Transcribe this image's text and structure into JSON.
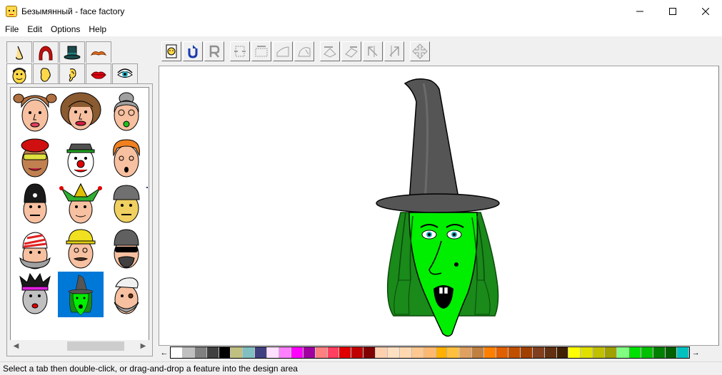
{
  "window": {
    "title": "Безымянный - face factory",
    "minimize_glyph": "—",
    "maximize_glyph": "☐",
    "close_glyph": "✕"
  },
  "menu": {
    "items": [
      "File",
      "Edit",
      "Options",
      "Help"
    ]
  },
  "feature_tabs": {
    "row1": [
      "nose-icon",
      "hair-icon",
      "hat-icon",
      "mustache-icon"
    ],
    "row2": [
      "face-icon",
      "head-shape-icon",
      "ear-icon",
      "lips-icon",
      "eye-icon"
    ],
    "active": "face-icon"
  },
  "toolbar": {
    "buttons": [
      "new-face-icon",
      "undo-icon",
      "redo-icon",
      "shrink-width-icon",
      "grow-width-icon",
      "shrink-height-icon",
      "grow-height-icon",
      "rotate-left-icon",
      "rotate-right-icon",
      "flip-horizontal-icon",
      "flip-vertical-icon",
      "move-icon"
    ]
  },
  "face_list": {
    "selected_index": 13,
    "faces": [
      "pigtails-girl",
      "curly-haired-woman",
      "gray-haired-woman",
      "beret-sunglasses-man",
      "clown",
      "red-haired-boy",
      "police-man",
      "jester",
      "helmet-man",
      "stocking-cap-man",
      "hardhat-worker",
      "biker",
      "punk",
      "witch",
      "old-sailor"
    ]
  },
  "palette": {
    "left_arrow": "←",
    "right_arrow": "→",
    "colors": [
      "#ffffff",
      "#c0c0c0",
      "#808080",
      "#404040",
      "#000000",
      "#c0c080",
      "#80c0c0",
      "#404080",
      "#ffe0ff",
      "#ff80ff",
      "#ff00ff",
      "#a000a0",
      "#ff8080",
      "#ff4060",
      "#e00000",
      "#c00000",
      "#800000",
      "#ffd0b0",
      "#ffe0c0",
      "#ffd8b0",
      "#ffc890",
      "#ffb870",
      "#ffb000",
      "#ffc040",
      "#e0a060",
      "#c08040",
      "#ff8000",
      "#e06000",
      "#c05000",
      "#a04000",
      "#804020",
      "#603010",
      "#402000",
      "#ffff00",
      "#e0e000",
      "#c0c000",
      "#a0a000",
      "#80ff80",
      "#00e000",
      "#00c000",
      "#008000",
      "#006000",
      "#00c0c0"
    ]
  },
  "status": {
    "text": "Select a tab then double-click, or drag-and-drop a feature into the design area"
  },
  "colors": {
    "selection": "#0078d7",
    "witch_skin": "#00ee00",
    "witch_hair": "#1a8a1a",
    "witch_hat": "#555555"
  }
}
